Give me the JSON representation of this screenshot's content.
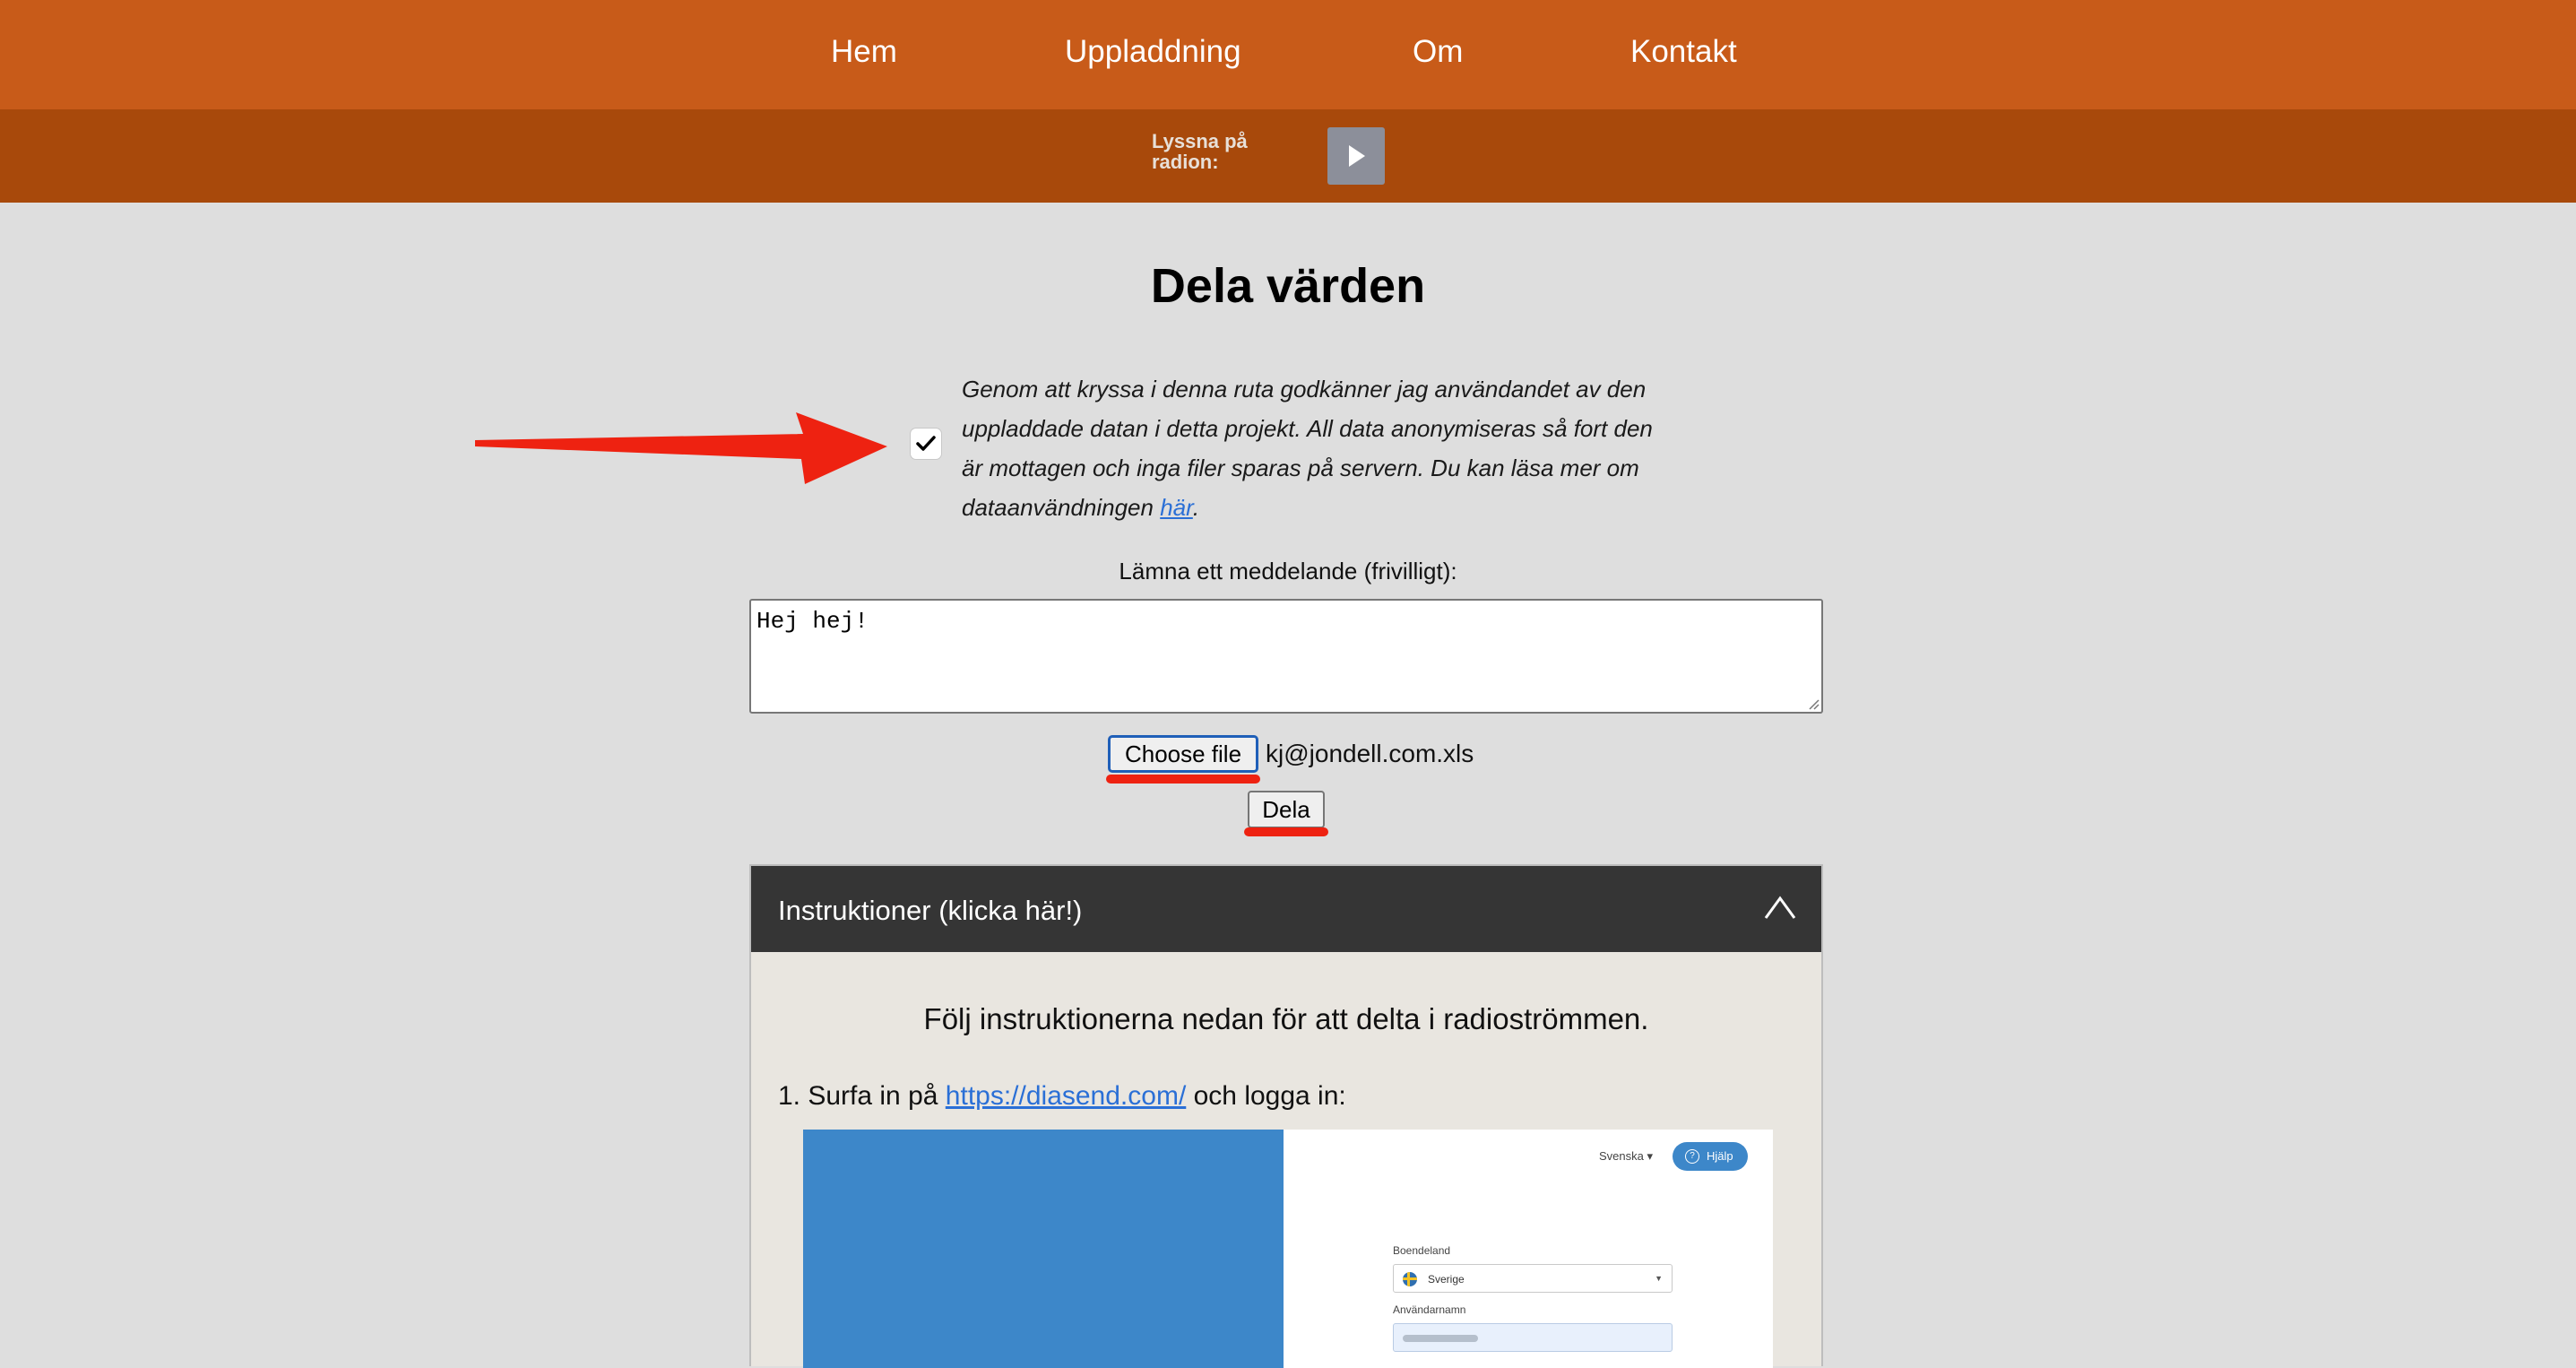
{
  "nav": {
    "items": [
      "Hem",
      "Uppladdning",
      "Om",
      "Kontakt"
    ]
  },
  "radio": {
    "label": "Lyssna på radion:",
    "play_icon": "play-icon"
  },
  "page": {
    "title": "Dela värden"
  },
  "consent": {
    "checked": true,
    "text": "Genom att kryssa i denna ruta godkänner jag användandet av den uppladdade datan i detta projekt. All data anonymiseras så fort den är mottagen och inga filer sparas på servern. Du kan läsa mer om dataanvändningen ",
    "link_text": "här",
    "suffix": "."
  },
  "message": {
    "label": "Lämna ett meddelande (frivilligt):",
    "value": "Hej hej!"
  },
  "file": {
    "button_label": "Choose file",
    "file_name": "kj@jondell.com.xls"
  },
  "submit": {
    "label": "Dela"
  },
  "instructions": {
    "header": "Instruktioner (klicka här!)",
    "intro": "Följ instruktionerna nedan för att delta i radioströmmen.",
    "step1_prefix": "1. Surfa in på ",
    "step1_link": "https://diasend.com/",
    "step1_suffix": " och logga in:"
  },
  "screenshot": {
    "language": "Svenska",
    "help_label": "Hjälp",
    "country_label": "Boendeland",
    "country_value": "Sverige",
    "username_label": "Användarnamn"
  },
  "colors": {
    "nav_bg": "#c85b19",
    "radio_bg": "#a8490b",
    "page_bg": "#dedede",
    "panel_header_bg": "#353535",
    "annotation_red": "#ee2211",
    "link": "#2a6fd6"
  }
}
